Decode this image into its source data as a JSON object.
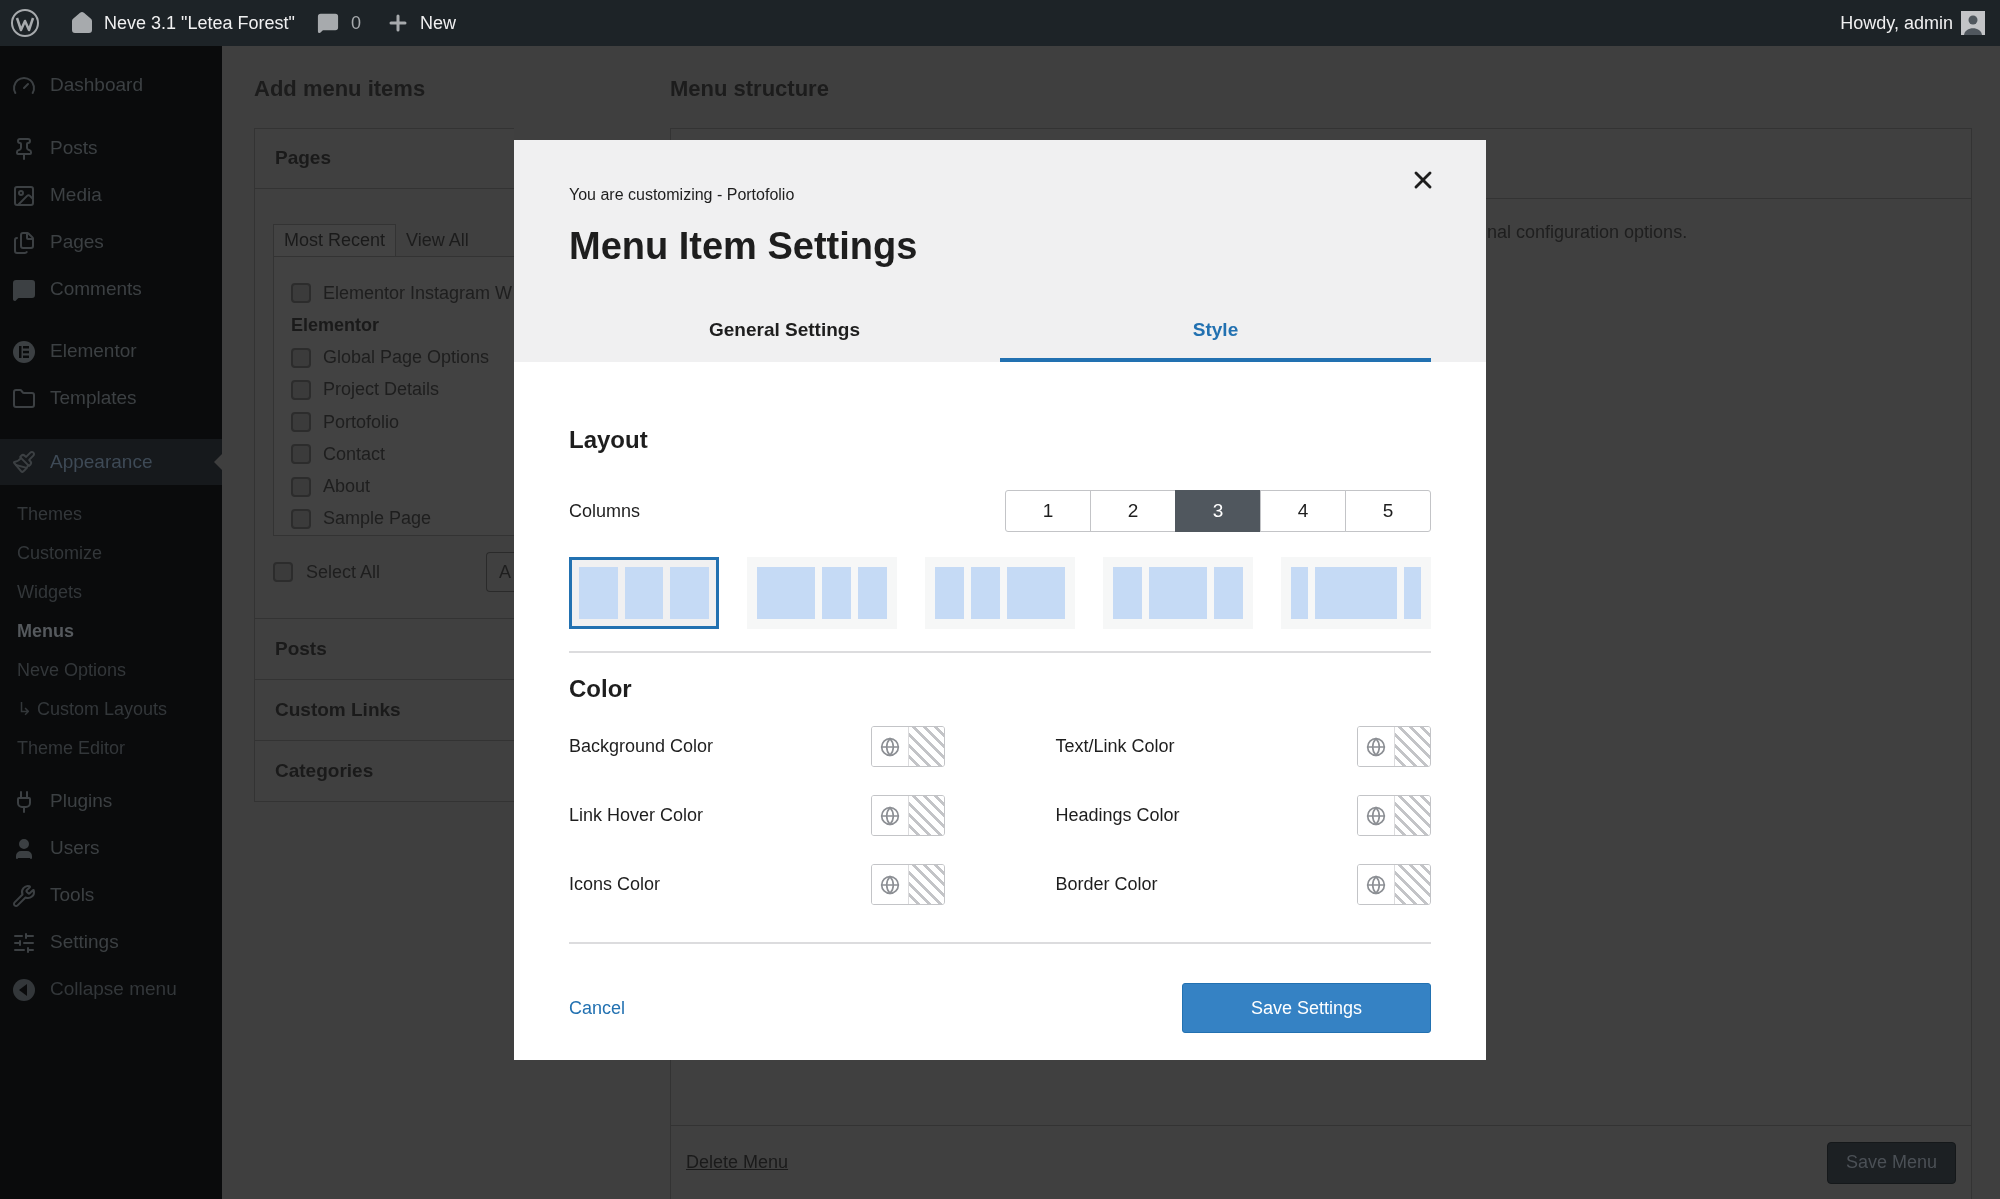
{
  "admin_bar": {
    "site_name": "Neve 3.1 \"Letea Forest\"",
    "comments_count": "0",
    "new_label": "New",
    "greeting": "Howdy, admin"
  },
  "sidebar": {
    "items": [
      {
        "label": "Dashboard",
        "current": false
      },
      {
        "label": "Posts",
        "current": false
      },
      {
        "label": "Media",
        "current": false
      },
      {
        "label": "Pages",
        "current": false
      },
      {
        "label": "Comments",
        "current": false
      },
      {
        "label": "Elementor",
        "current": false
      },
      {
        "label": "Templates",
        "current": false
      },
      {
        "label": "Appearance",
        "current": true,
        "submenu": [
          {
            "label": "Themes",
            "current": false
          },
          {
            "label": "Customize",
            "current": false
          },
          {
            "label": "Widgets",
            "current": false
          },
          {
            "label": "Menus",
            "current": true
          },
          {
            "label": "Neve Options",
            "current": false
          },
          {
            "label": "↳ Custom Layouts",
            "current": false
          },
          {
            "label": "Theme Editor",
            "current": false
          }
        ]
      },
      {
        "label": "Plugins",
        "current": false
      },
      {
        "label": "Users",
        "current": false
      },
      {
        "label": "Tools",
        "current": false
      },
      {
        "label": "Settings",
        "current": false
      }
    ],
    "collapse_label": "Collapse menu"
  },
  "add_menu_items": {
    "title": "Add menu items",
    "panels": [
      {
        "title": "Pages",
        "expanded": true,
        "tabs": [
          {
            "label": "Most Recent",
            "selected": true
          },
          {
            "label": "View All",
            "selected": false
          }
        ],
        "items": [
          {
            "kind": "page",
            "label": "Elementor Instagram W",
            "checked": false
          },
          {
            "kind": "group",
            "label": "Elementor"
          },
          {
            "kind": "page",
            "label": "Global Page Options",
            "checked": false
          },
          {
            "kind": "page",
            "label": "Project Details",
            "checked": false
          },
          {
            "kind": "page",
            "label": "Portofolio",
            "checked": false
          },
          {
            "kind": "page",
            "label": "Contact",
            "checked": false
          },
          {
            "kind": "page",
            "label": "About",
            "checked": false
          },
          {
            "kind": "page",
            "label": "Sample Page",
            "checked": false
          }
        ],
        "select_all": {
          "label": "Select All",
          "checked": false
        },
        "add_button": "A"
      },
      {
        "title": "Posts",
        "expanded": false
      },
      {
        "title": "Custom Links",
        "expanded": false
      },
      {
        "title": "Categories",
        "expanded": false
      }
    ]
  },
  "menu_structure": {
    "title": "Menu structure",
    "description": "nal configuration options.",
    "delete_label": "Delete Menu",
    "save_label": "Save Menu"
  },
  "modal": {
    "context": "You are customizing - Portofolio",
    "title": "Menu Item Settings",
    "tabs": [
      {
        "label": "General Settings",
        "selected": false
      },
      {
        "label": "Style",
        "selected": true
      }
    ],
    "layout": {
      "heading": "Layout",
      "columns_label": "Columns",
      "columns": [
        {
          "label": "1",
          "selected": false
        },
        {
          "label": "2",
          "selected": false
        },
        {
          "label": "3",
          "selected": true
        },
        {
          "label": "4",
          "selected": false
        },
        {
          "label": "5",
          "selected": false
        }
      ],
      "presets": [
        {
          "kind": "equal",
          "selected": true
        },
        {
          "kind": "wide-left",
          "selected": false
        },
        {
          "kind": "wide-right",
          "selected": false
        },
        {
          "kind": "wide-center",
          "selected": false
        },
        {
          "kind": "extra-wide-center",
          "selected": false
        }
      ]
    },
    "color": {
      "heading": "Color",
      "fields": [
        {
          "label": "Background Color"
        },
        {
          "label": "Text/Link Color"
        },
        {
          "label": "Link Hover Color"
        },
        {
          "label": "Headings Color"
        },
        {
          "label": "Icons Color"
        },
        {
          "label": "Border Color"
        }
      ]
    },
    "cancel": "Cancel",
    "save": "Save Settings"
  }
}
